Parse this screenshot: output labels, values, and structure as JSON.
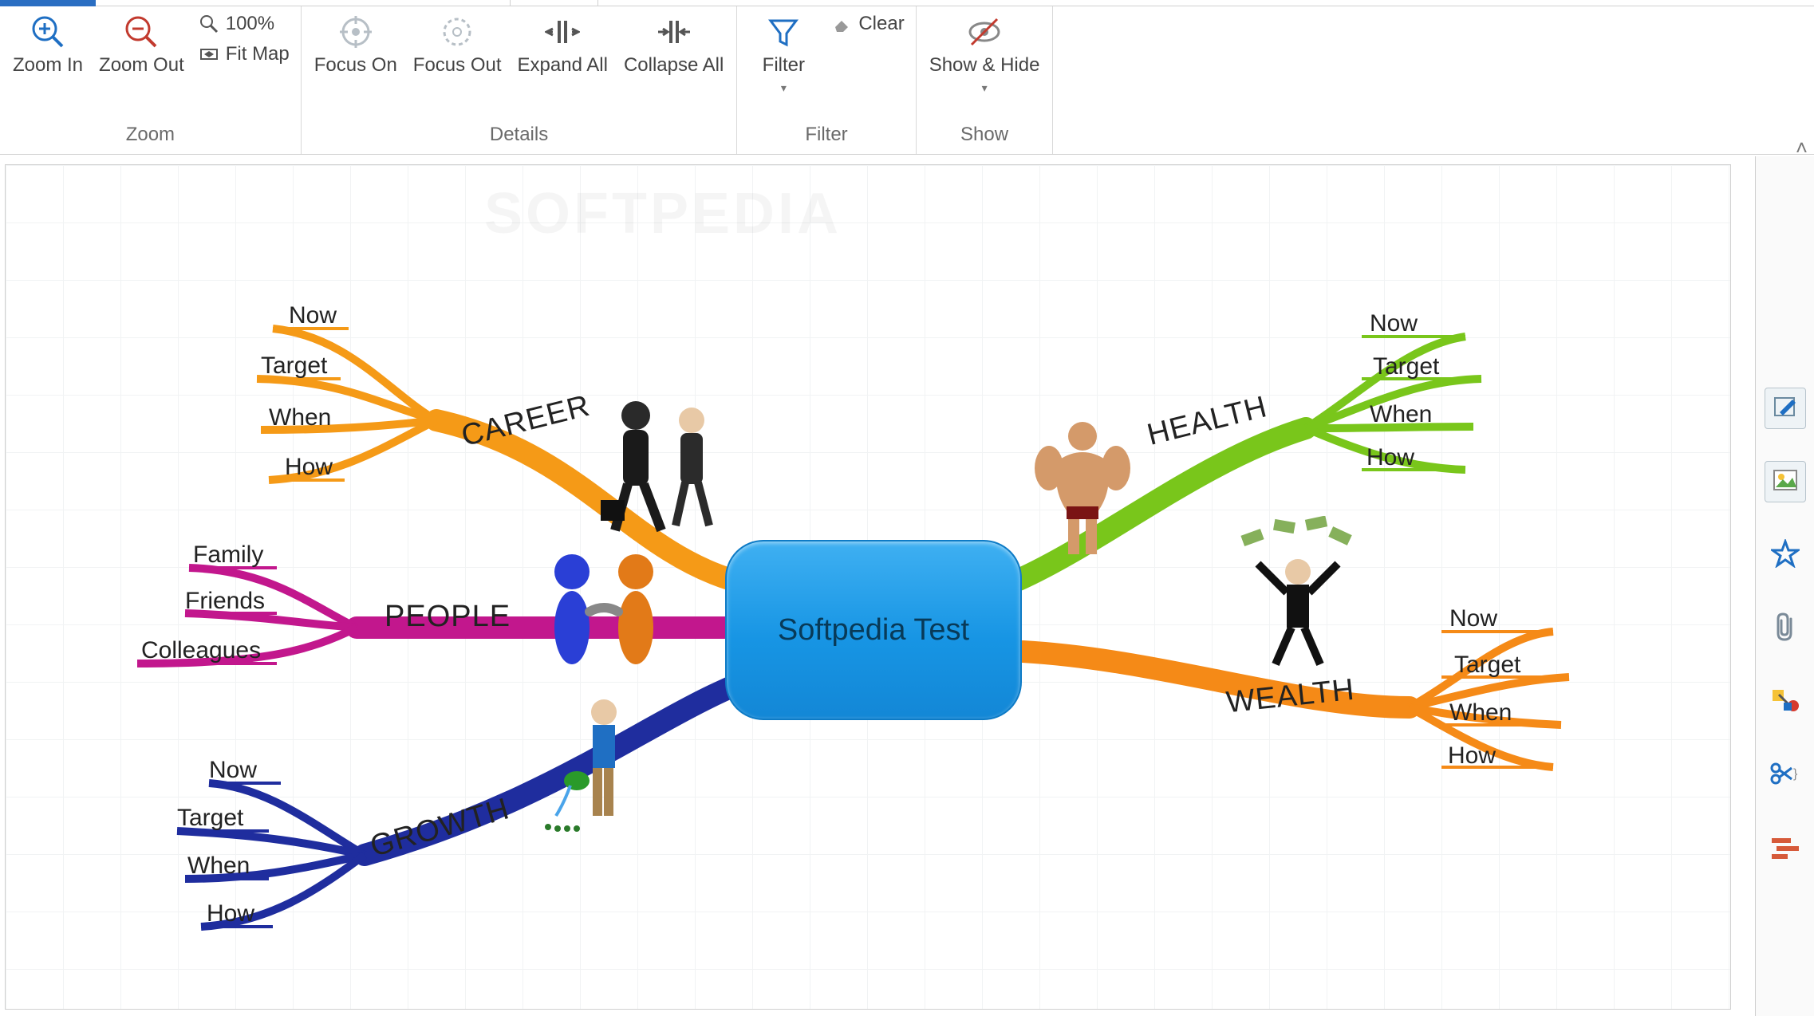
{
  "ribbon": {
    "groups": {
      "zoom": {
        "label": "Zoom",
        "zoom_in": "Zoom In",
        "zoom_out": "Zoom Out",
        "zoom_level": "100%",
        "fit_map": "Fit Map"
      },
      "details": {
        "label": "Details",
        "focus_on": "Focus On",
        "focus_out": "Focus Out",
        "expand_all": "Expand All",
        "collapse_all": "Collapse All"
      },
      "filter": {
        "label": "Filter",
        "filter": "Filter",
        "clear": "Clear"
      },
      "show": {
        "label": "Show",
        "show_hide": "Show & Hide"
      }
    }
  },
  "mindmap": {
    "center": "Softpedia Test",
    "watermark": "SOFTPEDIA",
    "branches": {
      "career": {
        "label": "CAREER",
        "color": "#f59a17",
        "leaves": [
          "Now",
          "Target",
          "When",
          "How"
        ]
      },
      "people": {
        "label": "PEOPLE",
        "color": "#c2178d",
        "leaves": [
          "Family",
          "Friends",
          "Colleagues"
        ]
      },
      "growth": {
        "label": "GROWTH",
        "color": "#1f2d9e",
        "leaves": [
          "Now",
          "Target",
          "When",
          "How"
        ]
      },
      "health": {
        "label": "HEALTH",
        "color": "#79c61b",
        "leaves": [
          "Now",
          "Target",
          "When",
          "How"
        ]
      },
      "wealth": {
        "label": "WEALTH",
        "color": "#f58a17",
        "leaves": [
          "Now",
          "Target",
          "When",
          "How"
        ]
      }
    }
  },
  "side": {
    "tools": [
      "edit-icon",
      "image-icon",
      "star-icon",
      "attachment-icon",
      "tag-icon",
      "cut-icon",
      "layout-icon"
    ]
  },
  "colors": {
    "ribbon_blue": "#1f6fc3",
    "icon_gray": "#9aa4ad"
  }
}
